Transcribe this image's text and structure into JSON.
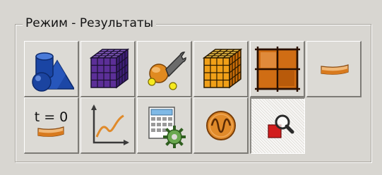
{
  "group": {
    "title": "Режим - Результаты"
  },
  "toolbar": {
    "row1": [
      {
        "icon": "geometry-shapes-icon"
      },
      {
        "icon": "mesh-cube-icon"
      },
      {
        "icon": "solver-settings-icon"
      },
      {
        "icon": "results-cube-icon"
      },
      {
        "icon": "grid-plane-icon"
      },
      {
        "icon": "deformed-shape-icon"
      }
    ],
    "row2": [
      {
        "icon": "initial-state-icon",
        "label": "t = 0"
      },
      {
        "icon": "graph-plot-icon"
      },
      {
        "icon": "calculator-settings-icon"
      },
      {
        "icon": "oscillation-icon"
      },
      {
        "icon": "zoom-probe-icon",
        "state": "pressed"
      }
    ]
  },
  "colors": {
    "background": "#d8d6d1",
    "geometry_blue": "#1f4aa8",
    "mesh_purple": "#5c2f98",
    "results_orange": "#f0a018",
    "plane_orange": "#d06d14",
    "graph_line": "#e08a2a",
    "probe_red": "#d21d1d"
  }
}
